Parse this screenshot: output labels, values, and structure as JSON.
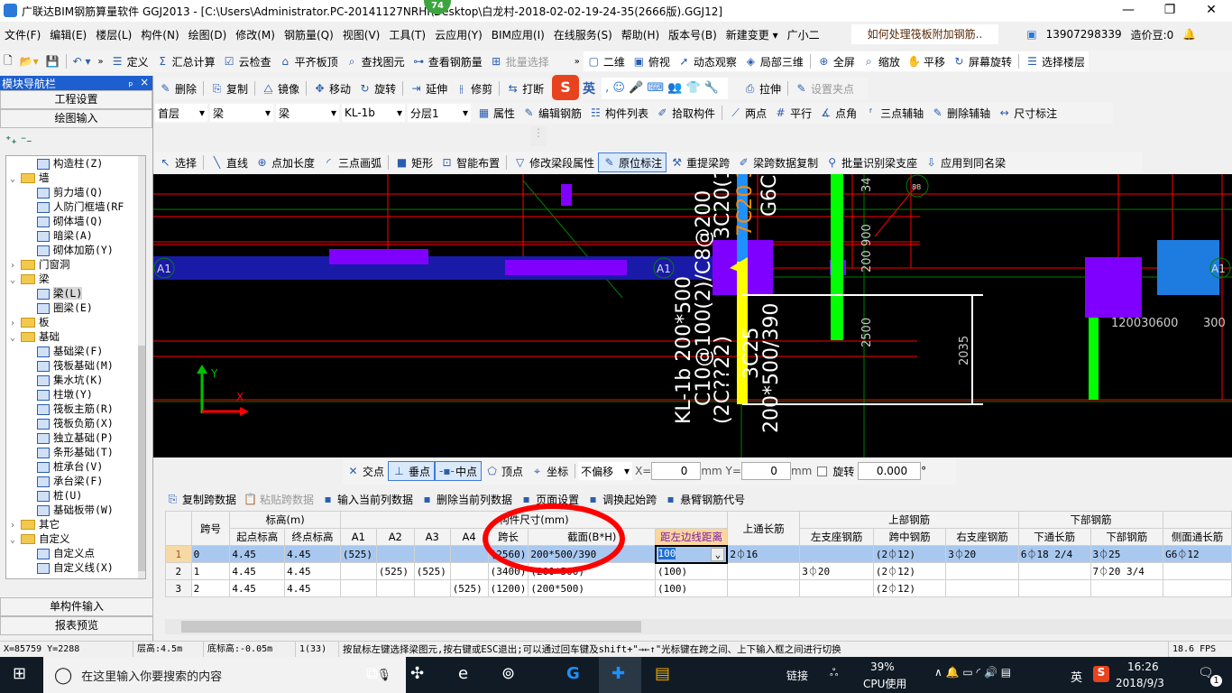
{
  "title": {
    "text": "广联达BIM钢筋算量软件 GGJ2013 - [C:\\Users\\Administrator.PC-20141127NRHI\\Desktop\\白龙村-2018-02-02-19-24-35(2666版).GGJ12]",
    "badge": "74",
    "min": "—",
    "max": "❐",
    "close": "✕"
  },
  "menu": [
    "文件(F)",
    "编辑(E)",
    "楼层(L)",
    "构件(N)",
    "绘图(D)",
    "修改(M)",
    "钢筋量(Q)",
    "视图(V)",
    "工具(T)",
    "云应用(Y)",
    "BIM应用(I)",
    "在线服务(S)",
    "帮助(H)",
    "版本号(B)",
    "新建变更 ▾",
    "广小二"
  ],
  "menu_right": {
    "question": "如何处理筏板附加钢筋..",
    "phone": "13907298339",
    "beans": "造价豆:0"
  },
  "toolbar1": [
    "定义",
    "汇总计算",
    "云检查",
    "平齐板顶",
    "查找图元",
    "查看钢筋量",
    "批量选择"
  ],
  "toolbar1_right": [
    "二维",
    "俯视",
    "动态观察",
    "局部三维",
    "全屏",
    "缩放",
    "平移",
    "屏幕旋转",
    "选择楼层"
  ],
  "nav": {
    "title": "模块导航栏",
    "pin": "ₚ",
    "close": "×",
    "project_settings": "工程设置",
    "drawing_input": "绘图输入",
    "single_input": "单构件输入",
    "report_preview": "报表预览"
  },
  "tree": [
    {
      "label": "构造柱(Z)",
      "level": 2
    },
    {
      "label": "墙",
      "level": 1,
      "open": true
    },
    {
      "label": "剪力墙(Q)",
      "level": 2
    },
    {
      "label": "人防门框墙(RF",
      "level": 2
    },
    {
      "label": "砌体墙(Q)",
      "level": 2
    },
    {
      "label": "暗梁(A)",
      "level": 2
    },
    {
      "label": "砌体加筋(Y)",
      "level": 2
    },
    {
      "label": "门窗洞",
      "level": 1,
      "open": false
    },
    {
      "label": "梁",
      "level": 1,
      "open": true
    },
    {
      "label": "梁(L)",
      "level": 2,
      "selected": true
    },
    {
      "label": "圈梁(E)",
      "level": 2
    },
    {
      "label": "板",
      "level": 1,
      "open": false
    },
    {
      "label": "基础",
      "level": 1,
      "open": true
    },
    {
      "label": "基础梁(F)",
      "level": 2
    },
    {
      "label": "筏板基础(M)",
      "level": 2
    },
    {
      "label": "集水坑(K)",
      "level": 2
    },
    {
      "label": "柱墩(Y)",
      "level": 2
    },
    {
      "label": "筏板主筋(R)",
      "level": 2
    },
    {
      "label": "筏板负筋(X)",
      "level": 2
    },
    {
      "label": "独立基础(P)",
      "level": 2
    },
    {
      "label": "条形基础(T)",
      "level": 2
    },
    {
      "label": "桩承台(V)",
      "level": 2
    },
    {
      "label": "承台梁(F)",
      "level": 2
    },
    {
      "label": "桩(U)",
      "level": 2
    },
    {
      "label": "基础板带(W)",
      "level": 2
    },
    {
      "label": "其它",
      "level": 1,
      "open": false
    },
    {
      "label": "自定义",
      "level": 1,
      "open": true
    },
    {
      "label": "自定义点",
      "level": 2
    },
    {
      "label": "自定义线(X)",
      "level": 2
    }
  ],
  "toolbar2": [
    "删除",
    "复制",
    "镜像",
    "移动",
    "旋转",
    "延伸",
    "修剪",
    "打断"
  ],
  "toolbar2_right": [
    "拉伸",
    "设置夹点"
  ],
  "ime": "英",
  "toolbar3": {
    "floor": "首层",
    "type1": "梁",
    "type2": "梁",
    "member": "KL-1b",
    "layer": "分层1",
    "buttons": [
      "属性",
      "编辑钢筋",
      "构件列表",
      "拾取构件",
      "两点",
      "平行",
      "点角",
      "三点辅轴",
      "删除辅轴",
      "尺寸标注"
    ]
  },
  "toolbar4": [
    "选择",
    "直线",
    "点加长度",
    "三点画弧",
    "矩形",
    "智能布置",
    "修改梁段属性",
    "原位标注",
    "重提梁跨",
    "梁跨数据复制",
    "批量识别梁支座",
    "应用到同名梁"
  ],
  "canvas": {
    "axis_labels": [
      "A1",
      "A1",
      "A1",
      "88"
    ],
    "beam_label": "KL-1b 200*500",
    "stirrup": "C10@100(2)/C8@200",
    "line3": "(2C??22)",
    "line4": "3C25",
    "line5": "200*500/390",
    "top1": "3C20(1)",
    "top2": "7C20 3/4",
    "top3": "G6C12",
    "dim_2035": "2035",
    "dim_2500": "2500",
    "dim_200_900": "200 900",
    "dim_34": "34",
    "right_dims": "120030600",
    "right_dims2": "300",
    "y_axis": "Y",
    "x_axis": "X"
  },
  "snap": {
    "items": [
      "交点",
      "垂点",
      "中点",
      "顶点",
      "坐标"
    ],
    "offset": "不偏移",
    "x_label": "X=",
    "x": "0",
    "y_label": "mm Y=",
    "y": "0",
    "mm": "mm",
    "rotate": "旋转",
    "angle": "0.000",
    "deg": "°"
  },
  "table_toolbar": [
    "复制跨数据",
    "粘贴跨数据",
    "输入当前列数据",
    "删除当前列数据",
    "页面设置",
    "调换起始跨",
    "悬臂钢筋代号"
  ],
  "table": {
    "group_headers": {
      "span": "跨号",
      "elev": "标高(m)",
      "size": "构件尺寸(mm)",
      "top_long": "上通长筋",
      "top_rebar": "上部钢筋",
      "bottom_rebar": "下部钢筋"
    },
    "columns": [
      "起点标高",
      "终点标高",
      "A1",
      "A2",
      "A3",
      "A4",
      "跨长",
      "截面(B*H)",
      "距左边线距离",
      "左支座钢筋",
      "跨中钢筋",
      "右支座钢筋",
      "下通长筋",
      "下部钢筋",
      "侧面通长筋"
    ],
    "rows": [
      [
        "1",
        "0",
        "4.45",
        "4.45",
        "(525)",
        "",
        "",
        "",
        "(2560)",
        "200*500/390",
        "100",
        "2⏀16",
        "",
        "(2⏀12)",
        "3⏀20",
        "6⏀18 2/4",
        "3⏀25",
        "G6⏀12"
      ],
      [
        "2",
        "1",
        "4.45",
        "4.45",
        "",
        "(525)",
        "(525)",
        "",
        "(3400)",
        "(200*500)",
        "(100)",
        "",
        "3⏀20",
        "(2⏀12)",
        "",
        "",
        "7⏀20 3/4",
        ""
      ],
      [
        "3",
        "2",
        "4.45",
        "4.45",
        "",
        "",
        "",
        "(525)",
        "(1200)",
        "(200*500)",
        "(100)",
        "",
        "",
        "(2⏀12)",
        "",
        "",
        "",
        ""
      ]
    ]
  },
  "status": {
    "coords": "X=85759 Y=2288",
    "floor_height": "层高:4.5m",
    "base_elev": "底标高:-0.05m",
    "count": "1(33)",
    "hint": "按鼠标左键选择梁图元,按右键或ESC退出;可以通过回车键及shift+\"→←↑\"光标键在跨之间、上下输入框之间进行切换",
    "fps": "18.6 FPS"
  },
  "taskbar": {
    "search": "在这里输入你要搜索的内容",
    "link": "链接",
    "cpu_pct": "39%",
    "cpu_label": "CPU使用",
    "ime": "英",
    "time": "16:26",
    "date": "2018/9/3",
    "notif": "1"
  },
  "colors": {
    "accent": "#1d5fcf",
    "canvas": "#000000",
    "beam_purple": "#8000ff",
    "rebar_green": "#00ff00",
    "annotation_red": "#ff0000"
  }
}
